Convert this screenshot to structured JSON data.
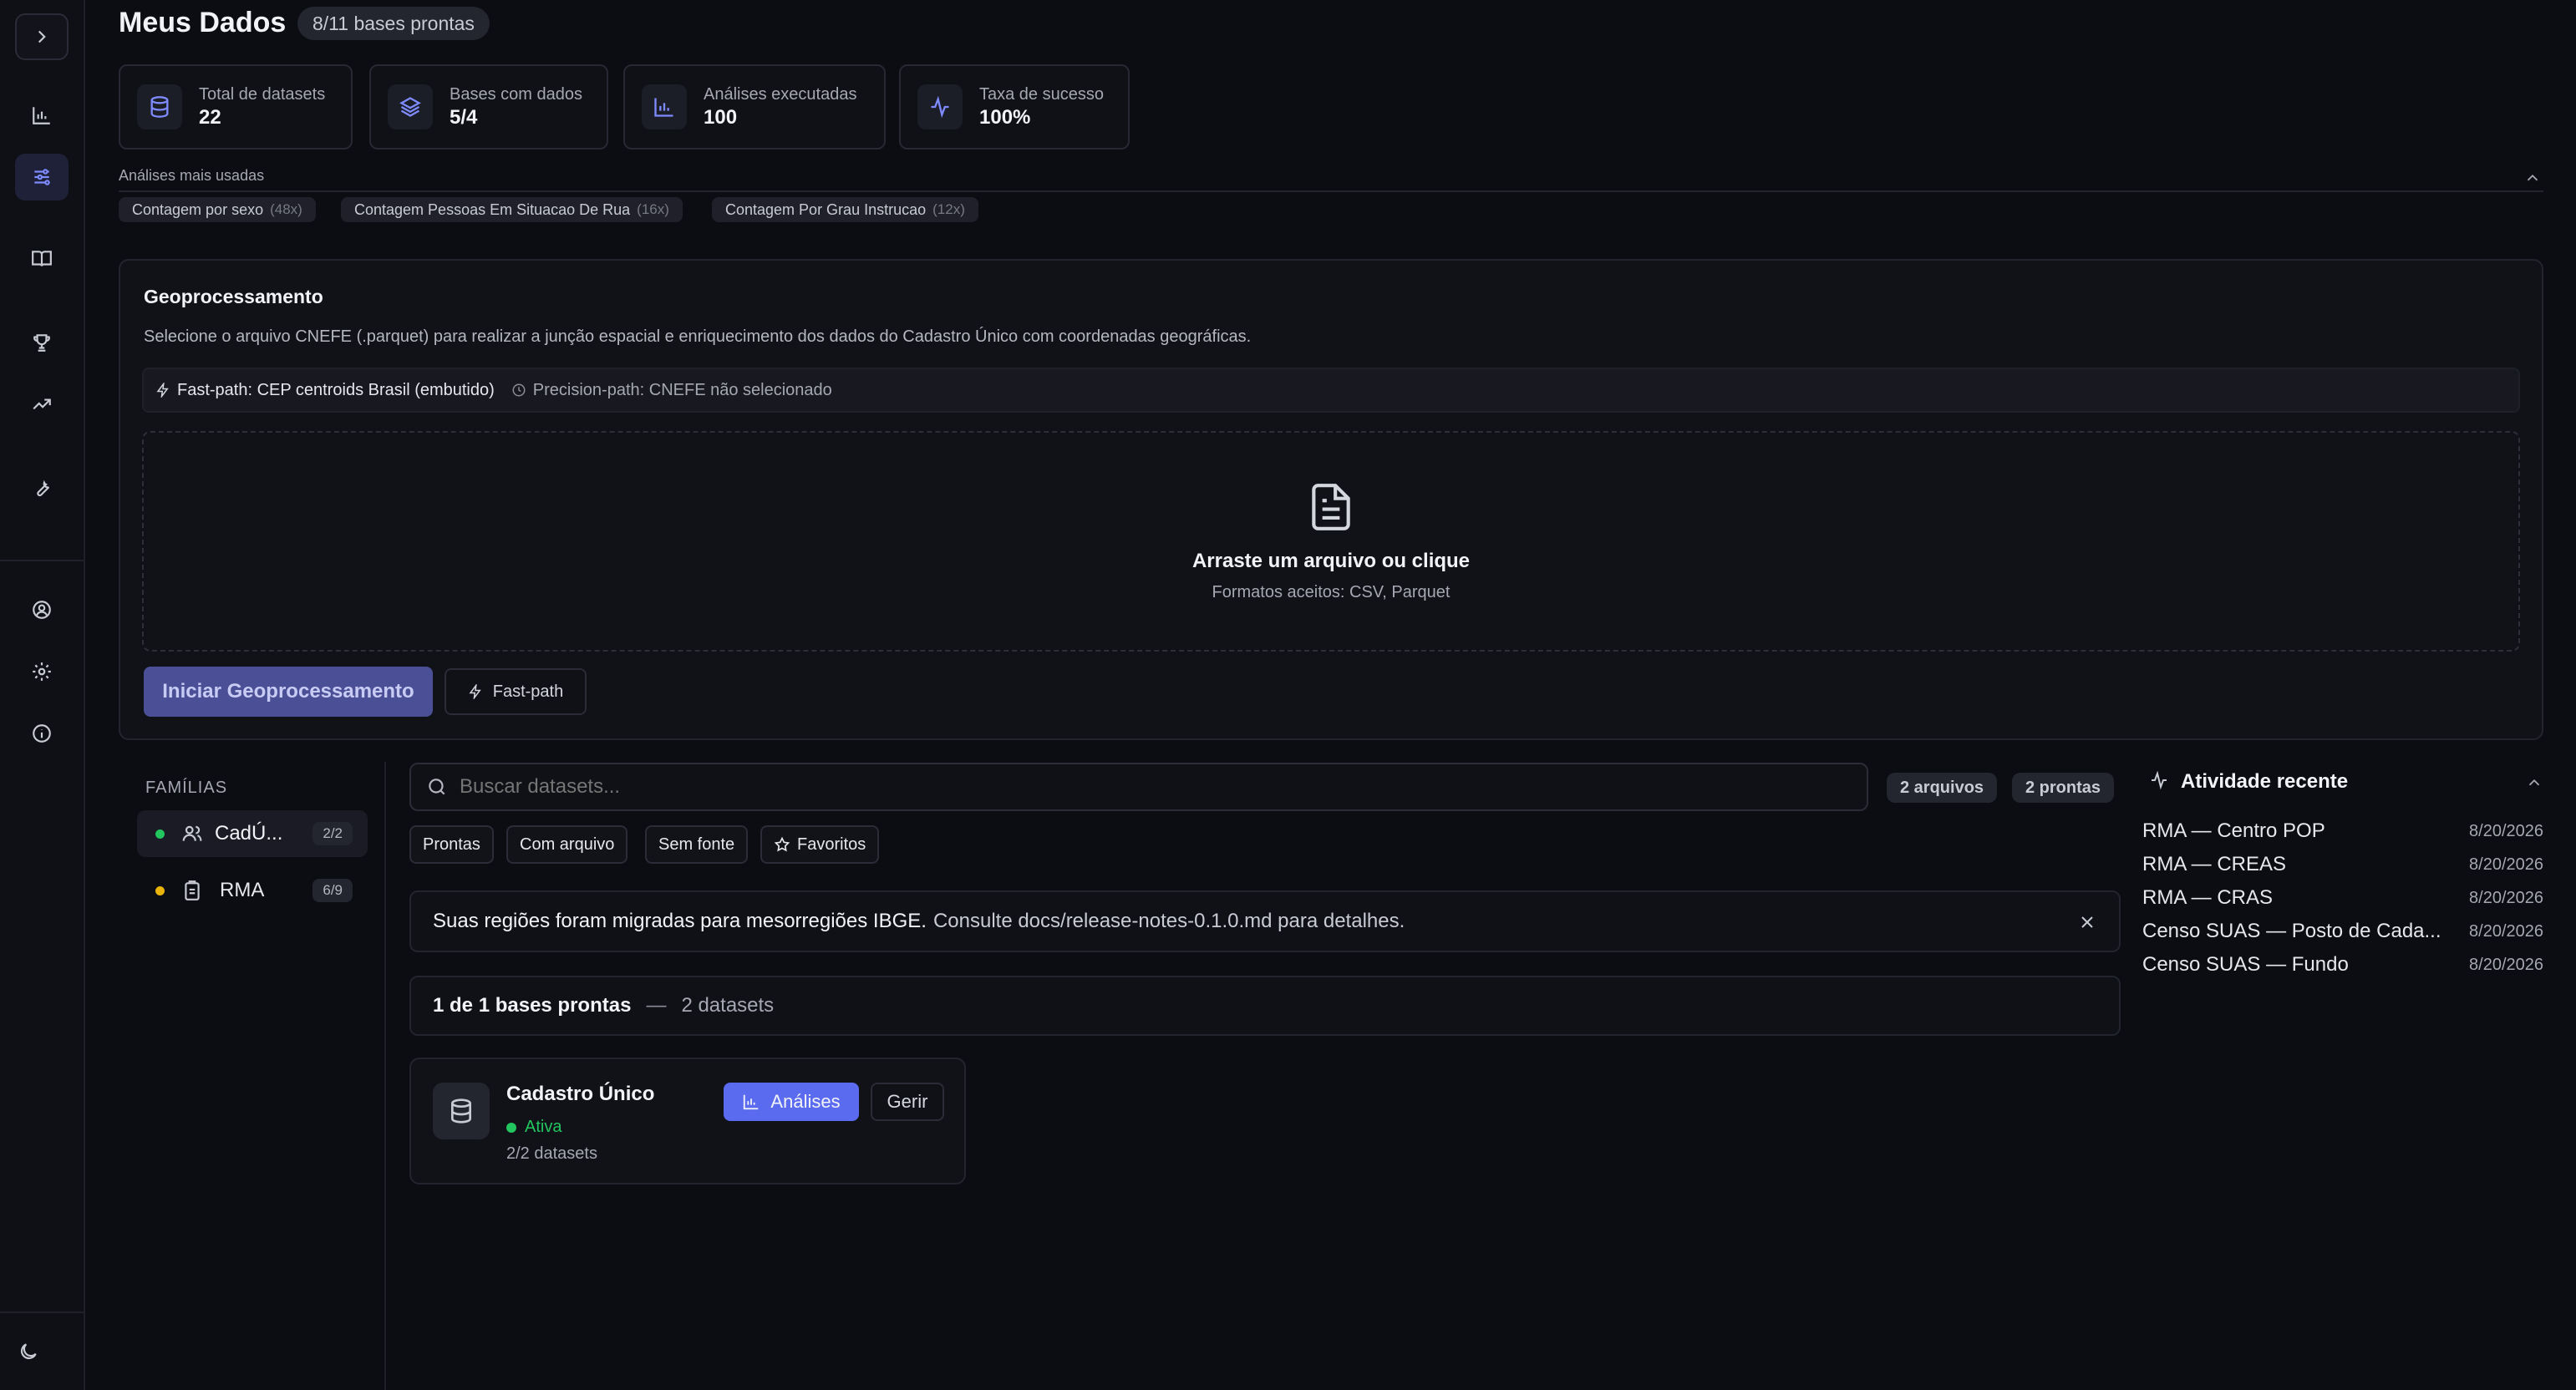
{
  "page": {
    "title": "Meus Dados",
    "status_badge": "8/11 bases prontas"
  },
  "stats": [
    {
      "label": "Total de datasets",
      "value": "22",
      "icon": "database-icon"
    },
    {
      "label": "Bases com dados",
      "value": "5/4",
      "icon": "layers-icon"
    },
    {
      "label": "Análises executadas",
      "value": "100",
      "icon": "bar-chart-icon"
    },
    {
      "label": "Taxa de sucesso",
      "value": "100%",
      "icon": "activity-icon"
    }
  ],
  "most_used": {
    "label": "Análises mais usadas",
    "tags": [
      {
        "name": "Contagem por sexo",
        "count": "(48x)"
      },
      {
        "name": "Contagem Pessoas Em Situacao De Rua",
        "count": "(16x)"
      },
      {
        "name": "Contagem Por Grau Instrucao",
        "count": "(12x)"
      }
    ]
  },
  "geo": {
    "title": "Geoprocessamento",
    "description": "Selecione o arquivo CNEFE (.parquet) para realizar a junção espacial e enriquecimento dos dados do Cadastro Único com coordenadas geográficas.",
    "fast_path": "Fast-path: CEP centroids Brasil (embutido)",
    "precision_path": "Precision-path: CNEFE não selecionado",
    "drop_title": "Arraste um arquivo ou clique",
    "drop_formats": "Formatos aceitos: CSV, Parquet",
    "start_button": "Iniciar Geoprocessamento",
    "fast_button": "Fast-path"
  },
  "families": {
    "heading": "FAMÍLIAS",
    "items": [
      {
        "label": "CadÚ...",
        "count": "2/2",
        "status_color": "#22c55e",
        "icon": "users-icon"
      },
      {
        "label": "RMA",
        "count": "6/9",
        "status_color": "#eab308",
        "icon": "clipboard-icon"
      }
    ]
  },
  "search": {
    "placeholder": "Buscar datasets...",
    "files_badge": "2 arquivos",
    "ready_badge": "2 prontas"
  },
  "filters": [
    "Prontas",
    "Com arquivo",
    "Sem fonte",
    "Favoritos"
  ],
  "notice": {
    "strong": "Suas regiões foram migradas para mesorregiões IBGE.",
    "rest": "Consulte docs/release-notes-0.1.0.md para detalhes."
  },
  "summary": {
    "ready": "1 de 1 bases prontas",
    "dash": "—",
    "datasets": "2 datasets"
  },
  "dataset_card": {
    "name": "Cadastro Único",
    "status": "Ativa",
    "count": "2/2 datasets",
    "analyses_button": "Análises",
    "manage_button": "Gerir"
  },
  "activity": {
    "title": "Atividade recente",
    "items": [
      {
        "name": "RMA — Centro POP",
        "date": "8/20/2026"
      },
      {
        "name": "RMA — CREAS",
        "date": "8/20/2026"
      },
      {
        "name": "RMA — CRAS",
        "date": "8/20/2026"
      },
      {
        "name": "Censo SUAS — Posto de Cada...",
        "date": "8/20/2026"
      },
      {
        "name": "Censo SUAS — Fundo",
        "date": "8/20/2026"
      }
    ]
  },
  "colors": {
    "accent": "#7f8cff",
    "primary_button": "#4a4f96",
    "background": "#0c0d12"
  }
}
